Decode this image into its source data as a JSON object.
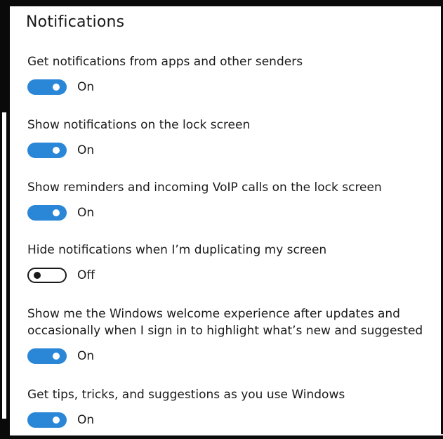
{
  "header": {
    "title": "Notifications"
  },
  "settings": [
    {
      "label": "Get notifications from apps and other senders",
      "state": "On",
      "enabled": true
    },
    {
      "label": "Show notifications on the lock screen",
      "state": "On",
      "enabled": true
    },
    {
      "label": "Show reminders and incoming VoIP calls on the lock screen",
      "state": "On",
      "enabled": true
    },
    {
      "label": "Hide notifications when I’m duplicating my screen",
      "state": "Off",
      "enabled": false
    },
    {
      "label": "Show me the Windows welcome experience after updates and\noccasionally when I sign in to highlight what’s new and suggested",
      "state": "On",
      "enabled": true
    },
    {
      "label": "Get tips, tricks, and suggestions as you use Windows",
      "state": "On",
      "enabled": true
    }
  ],
  "colors": {
    "toggle_on": "#2a86d6",
    "toggle_off_border": "#1a1a1a",
    "text": "#1a1a1a",
    "frame": "#0a0a0a"
  }
}
